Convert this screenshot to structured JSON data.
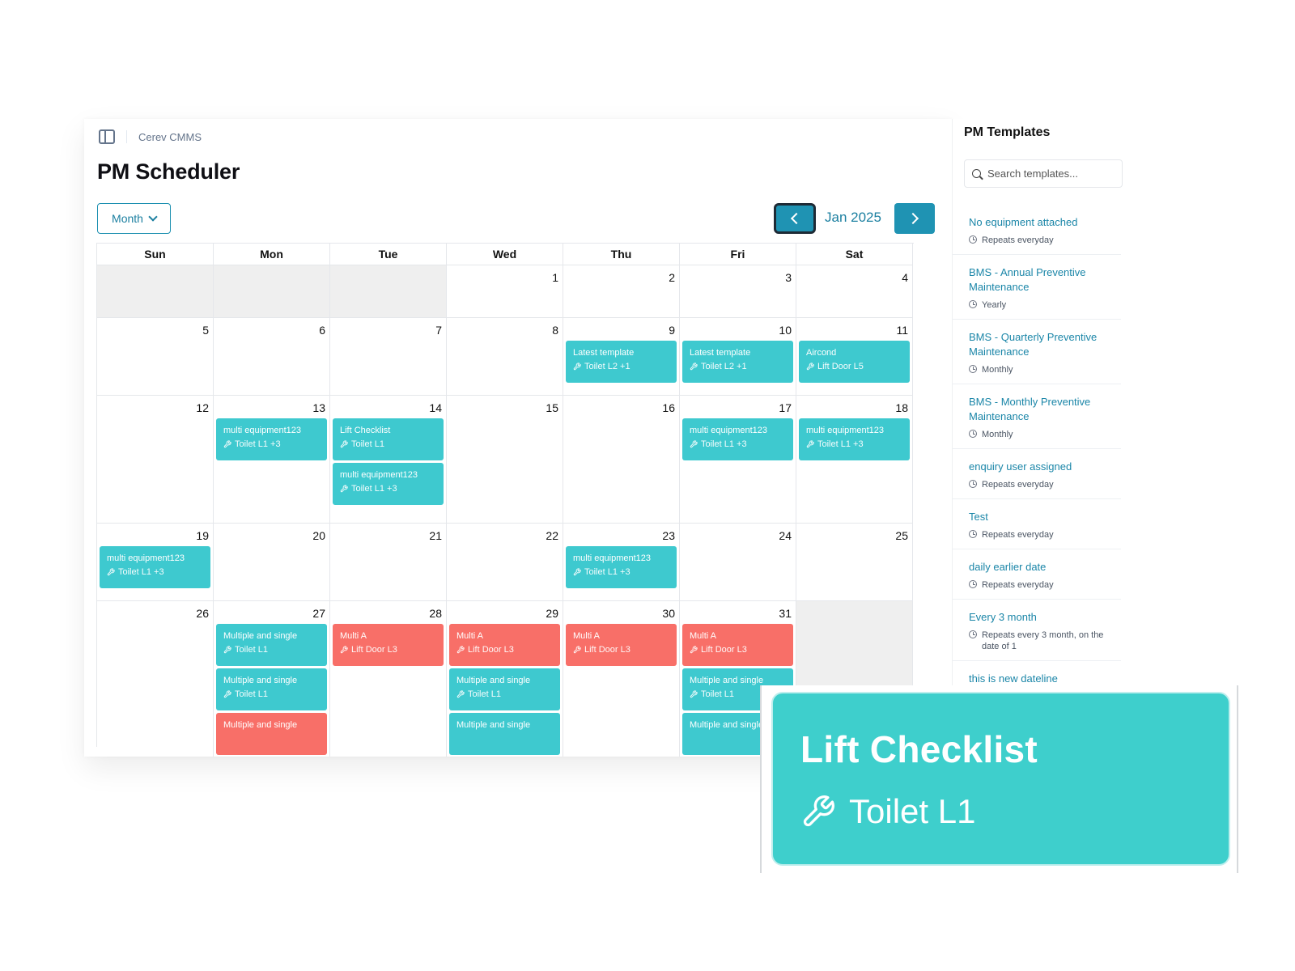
{
  "breadcrumb": "Cerev CMMS",
  "page_title": "PM Scheduler",
  "view_select": {
    "label": "Month"
  },
  "period": "Jan 2025",
  "weekdays": [
    "Sun",
    "Mon",
    "Tue",
    "Wed",
    "Thu",
    "Fri",
    "Sat"
  ],
  "weeks": [
    [
      {
        "day": "",
        "off": true,
        "events": []
      },
      {
        "day": "",
        "off": true,
        "events": []
      },
      {
        "day": "",
        "off": true,
        "events": []
      },
      {
        "day": "1",
        "events": []
      },
      {
        "day": "2",
        "events": []
      },
      {
        "day": "3",
        "events": []
      },
      {
        "day": "4",
        "events": []
      }
    ],
    [
      {
        "day": "5",
        "events": []
      },
      {
        "day": "6",
        "events": []
      },
      {
        "day": "7",
        "events": []
      },
      {
        "day": "8",
        "events": []
      },
      {
        "day": "9",
        "events": [
          {
            "title": "Latest template",
            "sub": "Toilet L2 +1",
            "color": "teal"
          }
        ]
      },
      {
        "day": "10",
        "events": [
          {
            "title": "Latest template",
            "sub": "Toilet L2 +1",
            "color": "teal"
          }
        ]
      },
      {
        "day": "11",
        "events": [
          {
            "title": "Aircond",
            "sub": "Lift Door L5",
            "color": "teal"
          }
        ]
      }
    ],
    [
      {
        "day": "12",
        "events": []
      },
      {
        "day": "13",
        "events": [
          {
            "title": "multi equipment123",
            "sub": "Toilet L1 +3",
            "color": "teal"
          }
        ]
      },
      {
        "day": "14",
        "events": [
          {
            "title": "Lift Checklist",
            "sub": "Toilet L1",
            "color": "teal"
          },
          {
            "title": "multi equipment123",
            "sub": "Toilet L1 +3",
            "color": "teal"
          }
        ]
      },
      {
        "day": "15",
        "events": []
      },
      {
        "day": "16",
        "events": []
      },
      {
        "day": "17",
        "events": [
          {
            "title": "multi equipment123",
            "sub": "Toilet L1 +3",
            "color": "teal"
          }
        ]
      },
      {
        "day": "18",
        "events": [
          {
            "title": "multi equipment123",
            "sub": "Toilet L1 +3",
            "color": "teal"
          }
        ]
      }
    ],
    [
      {
        "day": "19",
        "events": [
          {
            "title": "multi equipment123",
            "sub": "Toilet L1 +3",
            "color": "teal"
          }
        ]
      },
      {
        "day": "20",
        "events": []
      },
      {
        "day": "21",
        "events": []
      },
      {
        "day": "22",
        "events": []
      },
      {
        "day": "23",
        "events": [
          {
            "title": "multi equipment123",
            "sub": "Toilet L1 +3",
            "color": "teal"
          }
        ]
      },
      {
        "day": "24",
        "events": []
      },
      {
        "day": "25",
        "events": []
      }
    ],
    [
      {
        "day": "26",
        "events": []
      },
      {
        "day": "27",
        "events": [
          {
            "title": "Multiple and single",
            "sub": "Toilet L1",
            "color": "teal"
          },
          {
            "title": "Multiple and single",
            "sub": "Toilet L1",
            "color": "teal"
          },
          {
            "title": "Multiple and single",
            "sub": "",
            "color": "red"
          }
        ]
      },
      {
        "day": "28",
        "events": [
          {
            "title": "Multi A",
            "sub": "Lift Door L3",
            "color": "red"
          }
        ]
      },
      {
        "day": "29",
        "events": [
          {
            "title": "Multi A",
            "sub": "Lift Door L3",
            "color": "red"
          },
          {
            "title": "Multiple and single",
            "sub": "Toilet L1",
            "color": "teal"
          },
          {
            "title": "Multiple and single",
            "sub": "",
            "color": "teal"
          }
        ]
      },
      {
        "day": "30",
        "events": [
          {
            "title": "Multi A",
            "sub": "Lift Door L3",
            "color": "red"
          }
        ]
      },
      {
        "day": "31",
        "events": [
          {
            "title": "Multi A",
            "sub": "Lift Door L3",
            "color": "red"
          },
          {
            "title": "Multiple and single",
            "sub": "Toilet L1",
            "color": "teal"
          },
          {
            "title": "Multiple and single",
            "sub": "",
            "color": "teal"
          }
        ]
      },
      {
        "day": "",
        "off": true,
        "events": []
      }
    ]
  ],
  "templates_panel": {
    "title": "PM Templates",
    "search_placeholder": "Search templates...",
    "items": [
      {
        "name": "No equipment attached",
        "freq": "Repeats everyday"
      },
      {
        "name": "BMS - Annual Preventive Maintenance",
        "freq": "Yearly"
      },
      {
        "name": "BMS - Quarterly Preventive Maintenance",
        "freq": "Monthly"
      },
      {
        "name": "BMS - Monthly Preventive Maintenance",
        "freq": "Monthly"
      },
      {
        "name": "enquiry user assigned",
        "freq": "Repeats everyday"
      },
      {
        "name": "Test",
        "freq": "Repeats everyday"
      },
      {
        "name": "daily earlier date",
        "freq": "Repeats everyday"
      },
      {
        "name": "Every 3 month",
        "freq": "Repeats every 3 month, on the date of 1"
      },
      {
        "name": "this is new dateline",
        "freq": ""
      }
    ]
  },
  "callout": {
    "title": "Lift Checklist",
    "sub": "Toilet L1"
  },
  "colors": {
    "accent": "#1f93b3",
    "event_teal": "#3ec9cf",
    "event_red": "#f86f68",
    "link": "#1b86a8"
  },
  "icons": {
    "event_equipment": "wrench-icon",
    "template_frequency": "clock-icon",
    "search": "search-icon"
  }
}
